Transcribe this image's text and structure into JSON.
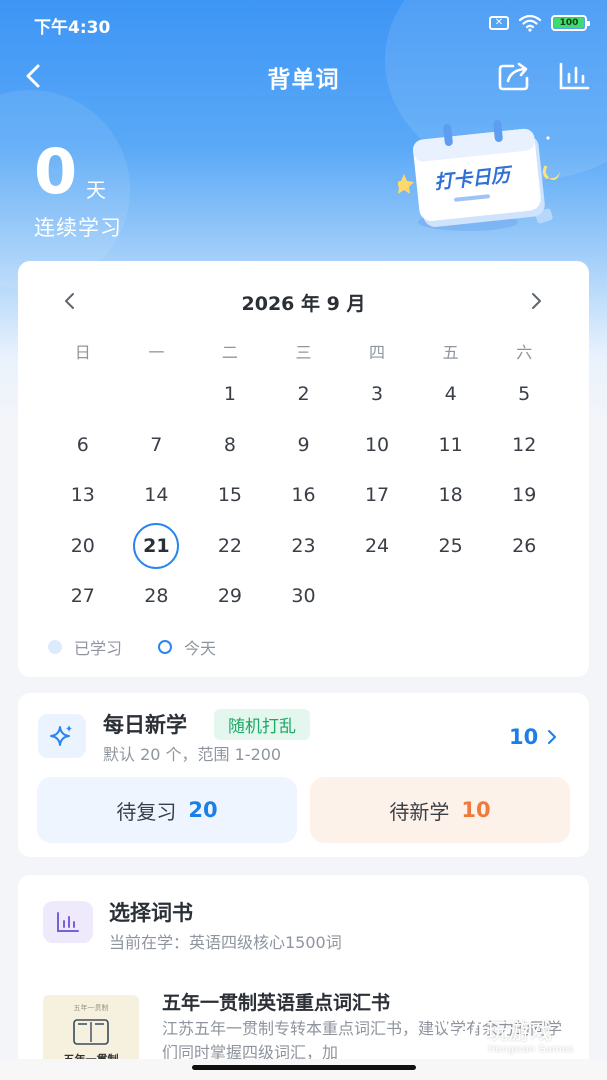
{
  "status_bar": {
    "time": "下午4:30",
    "battery": "100"
  },
  "nav": {
    "title": "背单词"
  },
  "streak": {
    "days": "0",
    "unit": "天",
    "label": "连续学习"
  },
  "checkin_badge": {
    "text": "打卡日历"
  },
  "calendar": {
    "month_label": "2026 年 9 月",
    "weekdays": [
      "日",
      "一",
      "二",
      "三",
      "四",
      "五",
      "六"
    ],
    "leading_blanks": 2,
    "days": [
      "1",
      "2",
      "3",
      "4",
      "5",
      "6",
      "7",
      "8",
      "9",
      "10",
      "11",
      "12",
      "13",
      "14",
      "15",
      "16",
      "17",
      "18",
      "19",
      "20",
      "21",
      "22",
      "23",
      "24",
      "25",
      "26",
      "27",
      "28",
      "29",
      "30"
    ],
    "today": "21",
    "legend": {
      "studied": "已学习",
      "today": "今天"
    }
  },
  "daily": {
    "title": "每日新学",
    "badge": "随机打乱",
    "subtitle": "默认 20 个，范围 1-200",
    "count": "10",
    "review_label": "待复习",
    "review_count": "20",
    "new_label": "待新学",
    "new_count": "10"
  },
  "book": {
    "title": "选择词书",
    "subtitle": "当前在学：英语四级核心1500词",
    "recommend_title": "五年一贯制英语重点词汇书",
    "recommend_desc": "江苏五年一贯制专转本重点词汇书，建议学有余力的同学们同时掌握四级词汇，加",
    "cover_top": "五年一贯制",
    "cover_text": "五年一贯制"
  },
  "watermark": {
    "text": "玩游戏",
    "sub": "Hengwan Games"
  },
  "colors": {
    "primary": "#2a86ee",
    "review": "#1b7fe8",
    "new": "#f07a3d",
    "badge": "#1fa866"
  }
}
